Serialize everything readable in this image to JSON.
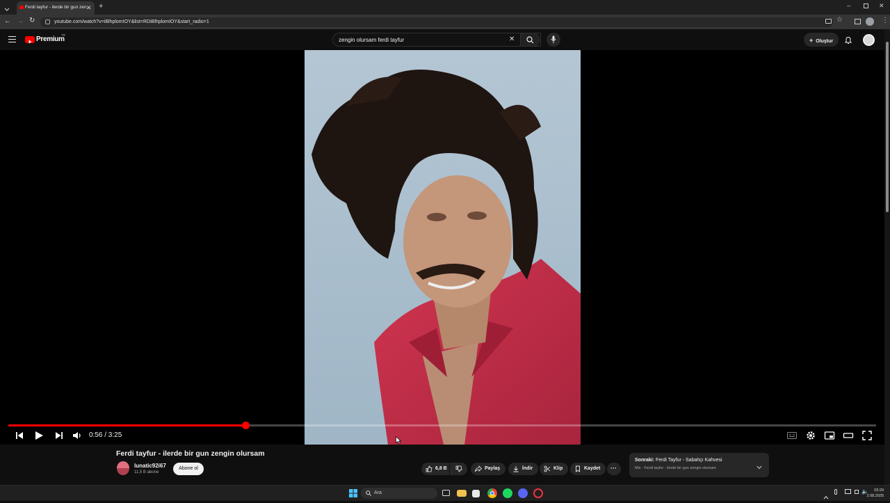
{
  "browser": {
    "tab_title": "Ferdi tayfur - ilerde bir gun zen...",
    "url": "youtube.com/watch?v=iBlhplomIOY&list=RDiBlhplomIOY&start_radio=1"
  },
  "header": {
    "logo_text": "Premium",
    "region": "TR",
    "search_query": "zengin olursam ferdi tayfur",
    "create_label": "Oluştur"
  },
  "player": {
    "current_time": "0:56",
    "duration": "3:25",
    "time_display": "0:56 / 3:25",
    "progress": 0.273
  },
  "video": {
    "title": "Ferdi tayfur - ilerde bir gun zengin olursam",
    "channel": "lunatic92i67",
    "subscribers": "11,5 B abone",
    "subscribe_label": "Abone ol",
    "likes": "6,8 B",
    "share_label": "Paylaş",
    "download_label": "İndir",
    "clip_label": "Klip",
    "save_label": "Kaydet"
  },
  "next": {
    "label": "Sonraki:",
    "title": "Ferdi Tayfur - Sabahçı Kahvesi",
    "subtitle": "Mix - Ferdi tayfur - ilerde bir gun zengin olursam"
  },
  "taskbar": {
    "search_placeholder": "Ara",
    "time": "03:29",
    "date": "2.08.2025"
  },
  "colors": {
    "accent": "#ff0000",
    "background": "#0f0f0f",
    "shirt": "#c4314a",
    "sky": "#a6bccd"
  }
}
